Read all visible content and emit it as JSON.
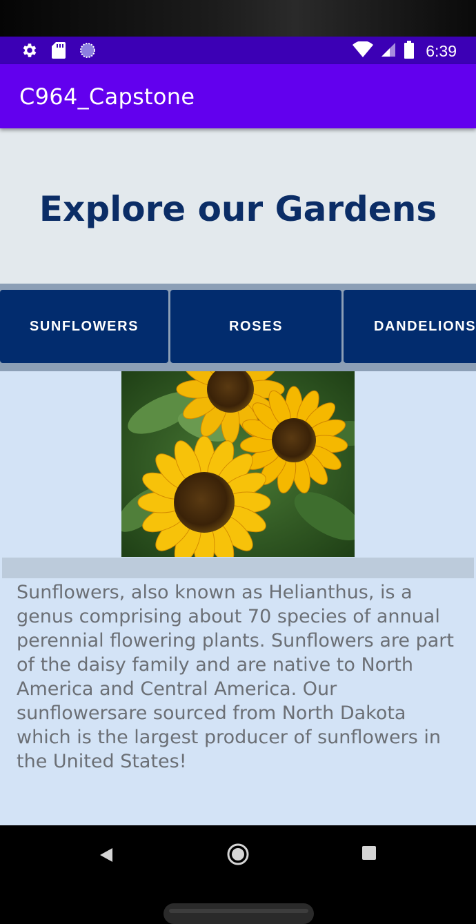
{
  "status_bar": {
    "time": "6:39",
    "icons_left": [
      "gear-icon",
      "sd-card-icon",
      "sync-circle-icon"
    ],
    "icons_right": [
      "wifi-icon",
      "cell-signal-icon",
      "battery-icon"
    ]
  },
  "app_bar": {
    "title": "C964_Capstone"
  },
  "hero": {
    "title": "Explore our Gardens"
  },
  "tabs": [
    {
      "label": "SUNFLOWERS"
    },
    {
      "label": "ROSES"
    },
    {
      "label": "DANDELIONS"
    }
  ],
  "detail": {
    "image": "sunflowers-photo",
    "description": "Sunflowers, also known as Helianthus, is a genus comprising about 70 species of annual perennial flowering plants. Sunflowers are part of the daisy family and are native to North America and Central America. Our sunflowersare sourced from North Dakota which is the largest producer of sunflowers in the United States!"
  },
  "nav_bar": {
    "buttons": [
      "back-icon",
      "home-icon",
      "recents-icon"
    ]
  },
  "colors": {
    "status_bar": "#3c00b5",
    "app_bar": "#6200ee",
    "hero_title": "#0b2d66",
    "tab": "#022c6e",
    "detail_bg": "#d3e3f6"
  }
}
